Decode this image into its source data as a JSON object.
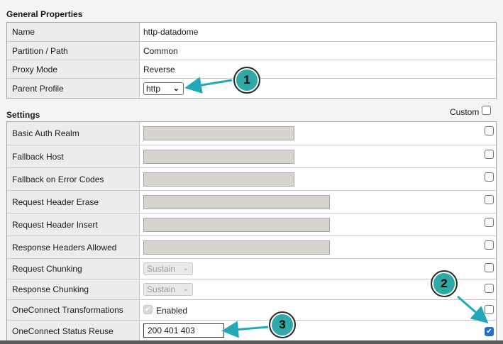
{
  "general": {
    "title": "General Properties",
    "rows": [
      {
        "label": "Name",
        "value": "http-datadome"
      },
      {
        "label": "Partition / Path",
        "value": "Common"
      },
      {
        "label": "Proxy Mode",
        "value": "Reverse"
      },
      {
        "label": "Parent Profile",
        "value": "http"
      }
    ]
  },
  "settings": {
    "title": "Settings",
    "custom_label": "Custom",
    "rows": [
      {
        "label": "Basic Auth Realm"
      },
      {
        "label": "Fallback Host"
      },
      {
        "label": "Fallback on Error Codes"
      },
      {
        "label": "Request Header Erase"
      },
      {
        "label": "Request Header Insert"
      },
      {
        "label": "Response Headers Allowed"
      },
      {
        "label": "Request Chunking",
        "value": "Sustain"
      },
      {
        "label": "Response Chunking",
        "value": "Sustain"
      },
      {
        "label": "OneConnect Transformations",
        "value": "Enabled"
      },
      {
        "label": "OneConnect Status Reuse",
        "value": "200 401 403"
      }
    ]
  },
  "callouts": [
    "1",
    "2",
    "3"
  ],
  "icons": {
    "checkmark": "✔",
    "chevron": "⌄"
  },
  "colors": {
    "callout": "#2ea9a6",
    "arrow": "#21a9b8",
    "checkbox_checked": "#1e6fd9"
  }
}
